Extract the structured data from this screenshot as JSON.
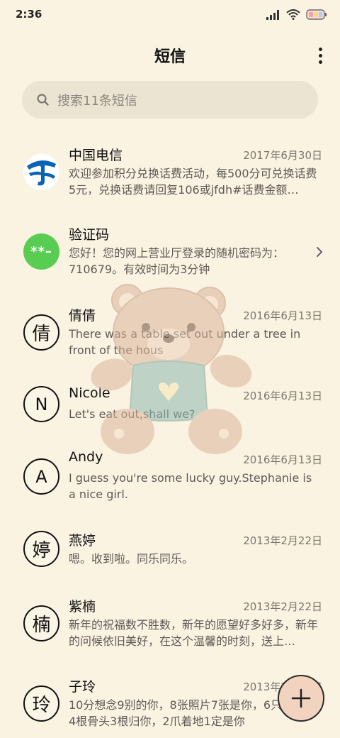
{
  "status_bar": {
    "time": "2:36"
  },
  "header": {
    "title": "短信"
  },
  "search": {
    "placeholder": "搜索11条短信"
  },
  "messages": [
    {
      "sender": "中国电信",
      "date": "2017年6月30日",
      "preview": "欢迎参加积分兑换话费活动，每500分可兑换话费5元，兑换话费请回复106或jfdh#话费金额…",
      "avatar": "telecom-logo"
    },
    {
      "sender": "验证码",
      "date": "",
      "preview": "您好！您的网上营业厅登录的随机密码为：710679。有效时间为3分钟",
      "avatar_text": "**–"
    },
    {
      "sender": "倩倩",
      "date": "2016年6月13日",
      "preview": "There was a table set out under a tree in front of the hous",
      "avatar_text": "倩"
    },
    {
      "sender": "Nicole",
      "date": "2016年6月13日",
      "preview": "Let's eat out,shall we?",
      "avatar_text": "N"
    },
    {
      "sender": "Andy",
      "date": "2016年6月13日",
      "preview": "I guess you're some lucky guy.Stephanie is a nice girl.",
      "avatar_text": "A"
    },
    {
      "sender": "燕婷",
      "date": "2013年2月22日",
      "preview": "嗯。收到啦。同乐同乐。",
      "avatar_text": "婷"
    },
    {
      "sender": "紫楠",
      "date": "2013年2月22日",
      "preview": "新年的祝福数不胜数，新年的愿望好多好多，新年的问候依旧美好，在这个温馨的时刻，送上…",
      "avatar_text": "楠"
    },
    {
      "sender": "子玲",
      "date": "2013年2月22日",
      "preview": "10分想念9别的你，8张照片7张是你，6只像你，4根骨头3根归你，2爪着地1定是你",
      "avatar_text": "玲"
    }
  ],
  "colors": {
    "background": "#faf3e2",
    "search_bg": "#ece4d2",
    "fab_bg": "#f1d3c0",
    "green_avatar": "#59cd52",
    "telecom_blue": "#0b63b7"
  }
}
